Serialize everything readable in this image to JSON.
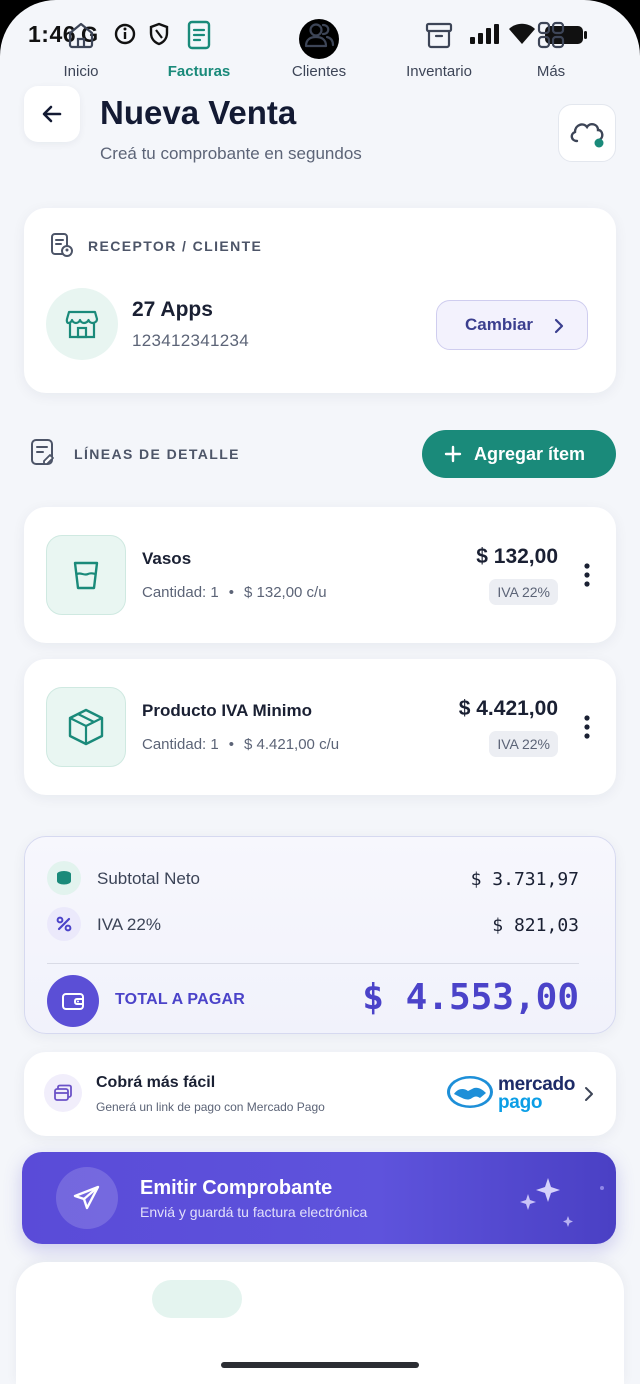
{
  "status_bar": {
    "time": "1:46",
    "left_icons": [
      "google-icon",
      "info-icon",
      "shield-icon"
    ],
    "right_icons": [
      "signal-icon",
      "wifi-icon",
      "battery-icon"
    ]
  },
  "header": {
    "title": "Nueva Venta",
    "subtitle": "Creá tu comprobante en segundos",
    "back_icon": "arrow-left-icon",
    "sync_icon": "cloud-sync-icon"
  },
  "receptor": {
    "label": "RECEPTOR / CLIENTE",
    "name": "27 Apps",
    "id": "123412341234",
    "change_label": "Cambiar"
  },
  "lines": {
    "label": "LÍNEAS DE DETALLE",
    "add_label": "Agregar ítem",
    "items": [
      {
        "name": "Vasos",
        "qty_label": "Cantidad: 1",
        "unit_price": "$ 132,00 c/u",
        "price": "$ 132,00",
        "iva": "IVA 22%",
        "icon": "cup-icon"
      },
      {
        "name": "Producto IVA Minimo",
        "qty_label": "Cantidad: 1",
        "unit_price": "$ 4.421,00 c/u",
        "price": "$ 4.421,00",
        "iva": "IVA 22%",
        "icon": "box-icon"
      }
    ]
  },
  "totals": {
    "subtotal_label": "Subtotal Neto",
    "subtotal_value": "$ 3.731,97",
    "iva_label": "IVA 22%",
    "iva_value": "$ 821,03",
    "total_label": "TOTAL A PAGAR",
    "total_value": "$ 4.553,00"
  },
  "mercado_pago": {
    "title": "Cobrá más fácil",
    "subtitle": "Generá un link de pago con Mercado Pago",
    "logo_line1": "mercado",
    "logo_line2": "pago"
  },
  "emit": {
    "title": "Emitir Comprobante",
    "subtitle": "Enviá y guardá tu factura electrónica"
  },
  "nav": {
    "items": [
      {
        "label": "Inicio",
        "icon": "home-icon"
      },
      {
        "label": "Facturas",
        "icon": "invoice-icon",
        "active": true
      },
      {
        "label": "Clientes",
        "icon": "users-icon"
      },
      {
        "label": "Inventario",
        "icon": "archive-icon"
      },
      {
        "label": "Más",
        "icon": "grid-icon"
      }
    ]
  },
  "colors": {
    "accent_teal": "#1a8a7a",
    "accent_purple": "#5b4fd6",
    "background": "#f4f6fa"
  }
}
